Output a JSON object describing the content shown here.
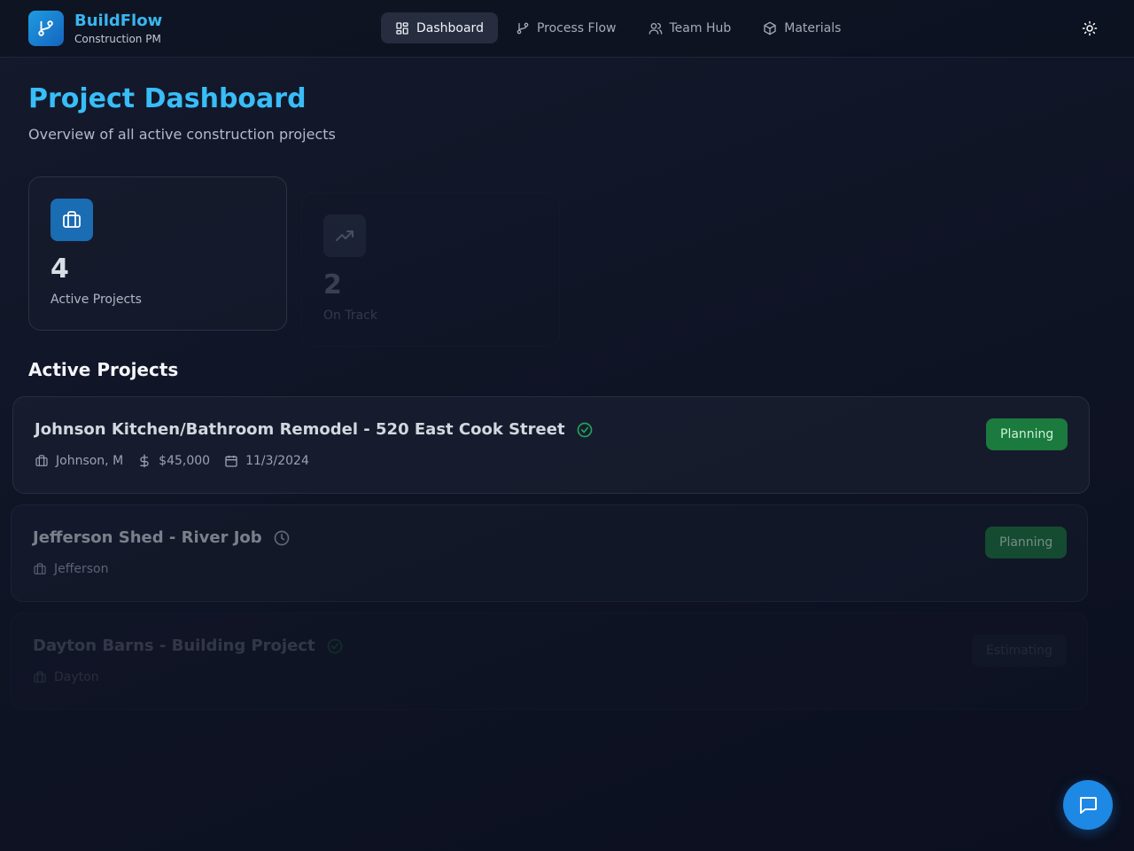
{
  "brand": {
    "title": "BuildFlow",
    "subtitle": "Construction PM"
  },
  "nav": [
    {
      "label": "Dashboard",
      "icon": "grid-icon",
      "active": true
    },
    {
      "label": "Process Flow",
      "icon": "git-branch-icon",
      "active": false
    },
    {
      "label": "Team Hub",
      "icon": "users-icon",
      "active": false
    },
    {
      "label": "Materials",
      "icon": "package-icon",
      "active": false
    }
  ],
  "page": {
    "title": "Project Dashboard",
    "subtitle": "Overview of all active construction projects"
  },
  "stats": [
    {
      "value": "4",
      "label": "Active Projects",
      "icon": "briefcase-icon"
    },
    {
      "value": "2",
      "label": "On Track",
      "icon": "trending-up-icon"
    }
  ],
  "section_title": "Active Projects",
  "projects": [
    {
      "name": "Johnson Kitchen/Bathroom Remodel - 520 East Cook Street",
      "status_icon": "check-circle-icon",
      "client": "Johnson, M",
      "budget": "$45,000",
      "date": "11/3/2024",
      "badge": "Planning"
    },
    {
      "name": "Jefferson Shed - River Job",
      "status_icon": "clock-icon",
      "client": "Jefferson",
      "badge": "Planning"
    },
    {
      "name": "Dayton Barns - Building Project",
      "status_icon": "check-circle-icon",
      "client": "Dayton",
      "badge": "Estimating"
    }
  ],
  "colors": {
    "accent": "#38bdf8",
    "planning_badge": "#1b7a3e",
    "fab": "#1e88e5"
  }
}
